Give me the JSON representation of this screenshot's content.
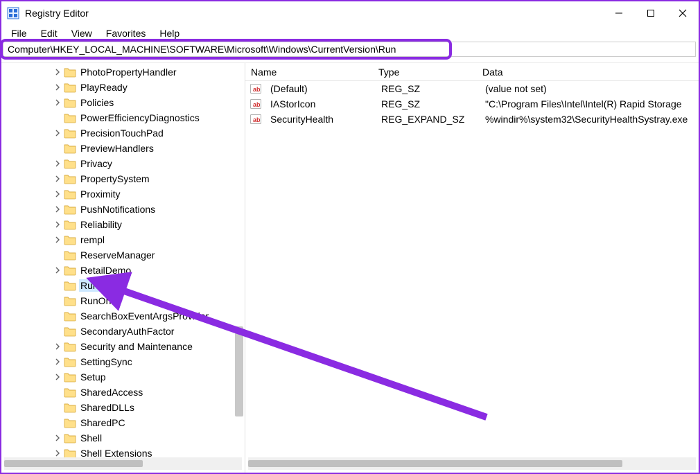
{
  "titlebar": {
    "title": "Registry Editor"
  },
  "menu": {
    "items": [
      "File",
      "Edit",
      "View",
      "Favorites",
      "Help"
    ]
  },
  "addressbar": {
    "path": "Computer\\HKEY_LOCAL_MACHINE\\SOFTWARE\\Microsoft\\Windows\\CurrentVersion\\Run"
  },
  "tree": {
    "items": [
      {
        "label": "PhotoPropertyHandler",
        "expandable": true,
        "selected": false
      },
      {
        "label": "PlayReady",
        "expandable": true,
        "selected": false
      },
      {
        "label": "Policies",
        "expandable": true,
        "selected": false
      },
      {
        "label": "PowerEfficiencyDiagnostics",
        "expandable": false,
        "selected": false
      },
      {
        "label": "PrecisionTouchPad",
        "expandable": true,
        "selected": false
      },
      {
        "label": "PreviewHandlers",
        "expandable": false,
        "selected": false
      },
      {
        "label": "Privacy",
        "expandable": true,
        "selected": false
      },
      {
        "label": "PropertySystem",
        "expandable": true,
        "selected": false
      },
      {
        "label": "Proximity",
        "expandable": true,
        "selected": false
      },
      {
        "label": "PushNotifications",
        "expandable": true,
        "selected": false
      },
      {
        "label": "Reliability",
        "expandable": true,
        "selected": false
      },
      {
        "label": "rempl",
        "expandable": true,
        "selected": false
      },
      {
        "label": "ReserveManager",
        "expandable": false,
        "selected": false
      },
      {
        "label": "RetailDemo",
        "expandable": true,
        "selected": false
      },
      {
        "label": "Run",
        "expandable": false,
        "selected": true
      },
      {
        "label": "RunOnce",
        "expandable": false,
        "selected": false,
        "covered_suffix": "nce"
      },
      {
        "label": "SearchBoxEventArgsProvider",
        "expandable": false,
        "selected": false,
        "covered_mid": "ventArgs"
      },
      {
        "label": "SecondaryAuthFactor",
        "expandable": false,
        "selected": false,
        "covered_suffix": "or"
      },
      {
        "label": "Security and Maintenance",
        "expandable": true,
        "selected": false,
        "covered_suffix": "nce"
      },
      {
        "label": "SettingSync",
        "expandable": true,
        "selected": false
      },
      {
        "label": "Setup",
        "expandable": true,
        "selected": false
      },
      {
        "label": "SharedAccess",
        "expandable": false,
        "selected": false
      },
      {
        "label": "SharedDLLs",
        "expandable": false,
        "selected": false
      },
      {
        "label": "SharedPC",
        "expandable": false,
        "selected": false
      },
      {
        "label": "Shell",
        "expandable": true,
        "selected": false
      },
      {
        "label": "Shell Extensions",
        "expandable": true,
        "selected": false
      }
    ]
  },
  "list": {
    "columns": {
      "name": "Name",
      "type": "Type",
      "data": "Data"
    },
    "rows": [
      {
        "name": "(Default)",
        "type": "REG_SZ",
        "data": "(value not set)"
      },
      {
        "name": "IAStorIcon",
        "type": "REG_SZ",
        "data": "\"C:\\Program Files\\Intel\\Intel(R) Rapid Storage "
      },
      {
        "name": "SecurityHealth",
        "type": "REG_EXPAND_SZ",
        "data": "%windir%\\system32\\SecurityHealthSystray.exe"
      }
    ]
  },
  "annotation": {
    "color": "#8a2be2"
  }
}
